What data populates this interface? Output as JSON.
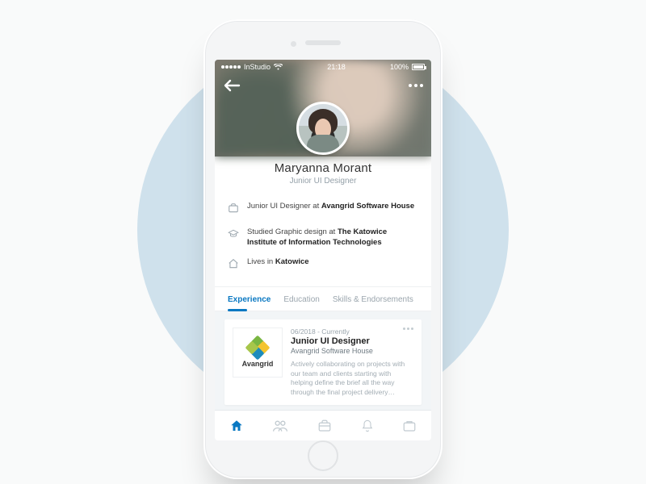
{
  "statusbar": {
    "carrier": "InStudio",
    "time": "21:18",
    "battery": "100%"
  },
  "profile": {
    "name": "Maryanna Morant",
    "title": "Junior UI Designer"
  },
  "info": {
    "job_prefix": "Junior UI Designer at ",
    "job_bold": "Avangrid Software House",
    "edu_prefix": "Studied Graphic design at ",
    "edu_bold": "The Katowice Institute of Information Technologies",
    "loc_prefix": "Lives in ",
    "loc_bold": "Katowice"
  },
  "tabs": {
    "experience": "Experience",
    "education": "Education",
    "skills": "Skills & Endorsements"
  },
  "experience": {
    "logo_name": "Avangrid",
    "daterange": "06/2018 - Currently",
    "title": "Junior UI Designer",
    "company": "Avangrid Software House",
    "description": "Actively collaborating on projects with our team and clients starting with helping define the brief all the way through the final project delivery…"
  }
}
